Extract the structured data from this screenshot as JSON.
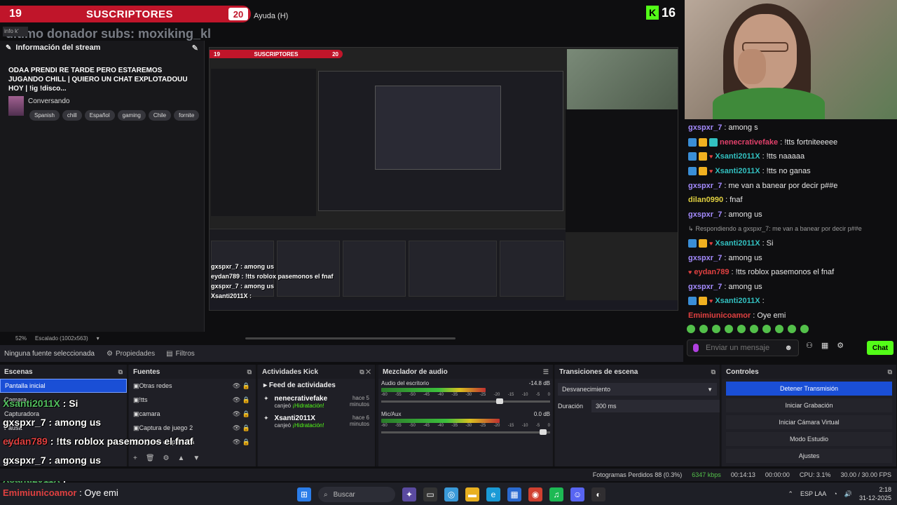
{
  "overlay": {
    "sub_left": "19",
    "sub_label": "SUSCRIPTORES",
    "sub_right": "20",
    "menu_help": "Ayuda (H)",
    "kick_followers": "16",
    "ghost_follow": "último donador subs: moxiking_kl",
    "info_chip": "info k'"
  },
  "stream_info": {
    "title": "Información del stream",
    "stream_title": "ODAA PRENDI RE TARDE PERO ESTAREMOS JUGANDO CHILL | QUIERO UN CHAT EXPLOTADOUU HOY | !ig !disco...",
    "category": "Conversando",
    "tags": [
      "Spanish",
      "chill",
      "Español",
      "gaming",
      "Chile",
      "fornite"
    ]
  },
  "preview": {
    "sub_left": "19",
    "sub_label": "SUSCRIPTORES",
    "sub_right": "20",
    "overlay_lines": [
      "gxspxr_7 : among us",
      "eydan789 : !tts roblox pasemonos el fnaf",
      "gxspxr_7 : among us",
      "Xsanti2011X :",
      "Emimiunicoamor : Oye emi"
    ]
  },
  "chat": {
    "messages": [
      {
        "user": "gxspxr_7",
        "color": "#a48bff",
        "text": "among s",
        "badges": []
      },
      {
        "user": "nenecrativefake",
        "color": "#e0406a",
        "text": "!tts fortniteeeee",
        "badges": [
          "b-blue",
          "b-yellow",
          "b-cyan"
        ]
      },
      {
        "user": "Xsanti2011X",
        "color": "#32c0c0",
        "text": "!tts naaaaa",
        "badges": [
          "b-blue",
          "b-yellow",
          "b-red"
        ]
      },
      {
        "user": "Xsanti2011X",
        "color": "#32c0c0",
        "text": "!tts no ganas",
        "badges": [
          "b-blue",
          "b-yellow",
          "b-red"
        ]
      },
      {
        "user": "gxspxr_7",
        "color": "#a48bff",
        "text": "me van a banear por decir p##e",
        "badges": []
      },
      {
        "user": "dilan0990",
        "color": "#e0d040",
        "text": "fnaf",
        "badges": []
      },
      {
        "user": "gxspxr_7",
        "color": "#a48bff",
        "text": "among us",
        "badges": []
      },
      {
        "reply": "Respondiendo a gxspxr_7: me van a banear por decir p##e"
      },
      {
        "user": "Xsanti2011X",
        "color": "#32c0c0",
        "text": "Si",
        "badges": [
          "b-blue",
          "b-yellow",
          "b-red"
        ]
      },
      {
        "user": "gxspxr_7",
        "color": "#a48bff",
        "text": "among us",
        "badges": []
      },
      {
        "user": "eydan789",
        "color": "#e04040",
        "text": "!tts roblox pasemonos el fnaf",
        "badges": [
          "b-red"
        ]
      },
      {
        "user": "gxspxr_7",
        "color": "#a48bff",
        "text": "among us",
        "badges": []
      },
      {
        "user": "Xsanti2011X",
        "color": "#32c0c0",
        "text": "",
        "badges": [
          "b-blue",
          "b-yellow",
          "b-red"
        ]
      },
      {
        "user": "Emimiunicoamor",
        "color": "#e04040",
        "text": "Oye emi",
        "badges": []
      }
    ],
    "input_placeholder": "Enviar un mensaje",
    "send_label": "Chat"
  },
  "obs": {
    "zoom": "52%",
    "scale": "Escalado (1002x563)",
    "no_source": "Ninguna fuente seleccionada",
    "properties": "Propiedades",
    "filters": "Filtros",
    "scenes": {
      "title": "Escenas",
      "items": [
        "Pantalla inicial",
        "Camara",
        "Capturadora",
        "Pausa",
        "Inicio"
      ]
    },
    "sources": {
      "title": "Fuentes",
      "items": [
        "Otras redes",
        "!tts",
        "camara",
        "Captura de juego 2",
        "Captura de pantalla"
      ]
    },
    "kick": {
      "title": "Actividades Kick",
      "feed_title": "Feed de actividades",
      "items": [
        {
          "who": "nenecrativefake",
          "what": "canjeó",
          "reward": "¡Hidratación!",
          "when": "hace 5 minutos"
        },
        {
          "who": "Xsanti2011X",
          "what": "canjeó",
          "reward": "¡Hidratación!",
          "when": "hace 6 minutos"
        }
      ]
    },
    "mixer": {
      "title": "Mezclador de audio",
      "tracks": [
        {
          "name": "Audio del escritorio",
          "db": "-14.8 dB",
          "level": 0.62,
          "volume": 0.72
        },
        {
          "name": "Mic/Aux",
          "db": "0.0 dB",
          "level": 0.7,
          "volume": 0.98
        }
      ],
      "scale": [
        "-60",
        "-55",
        "-50",
        "-45",
        "-40",
        "-35",
        "-30",
        "-25",
        "-20",
        "-15",
        "-10",
        "-5",
        "0"
      ]
    },
    "transitions": {
      "title": "Transiciones de escena",
      "selected": "Desvanecimiento",
      "duration_label": "Duración",
      "duration_value": "300 ms"
    },
    "controls": {
      "title": "Controles",
      "buttons": [
        "Detener Transmisión",
        "Iniciar Grabación",
        "Iniciar Cámara Virtual",
        "Modo Estudio",
        "Ajustes"
      ]
    }
  },
  "overlay_chat": [
    {
      "user": "Xsanti2011X",
      "text": "Si",
      "cls": "u1"
    },
    {
      "user": "gxspxr_7",
      "text": "among us",
      "cls": ""
    },
    {
      "user": "eydan789",
      "text": "!tts roblox pasemonos el fnaf",
      "cls": "u2"
    },
    {
      "user": "gxspxr_7",
      "text": "among us",
      "cls": ""
    },
    {
      "user": "Xsanti2011X",
      "text": "",
      "cls": "u1"
    }
  ],
  "status": {
    "dropped": "Fotogramas Perdidos 88 (0.3%)",
    "kbps": "6347 kbps",
    "time": "00:14:13",
    "time2": "00:00:00",
    "cpu": "CPU: 3.1%",
    "fps": "30.00 / 30.00 FPS"
  },
  "taskbar": {
    "chat_user": "Emimiunicoamor",
    "chat_text": "Oye emi",
    "search": "Buscar",
    "lang": "ESP LAA",
    "time": "2:18",
    "date": "31-12-2025"
  }
}
